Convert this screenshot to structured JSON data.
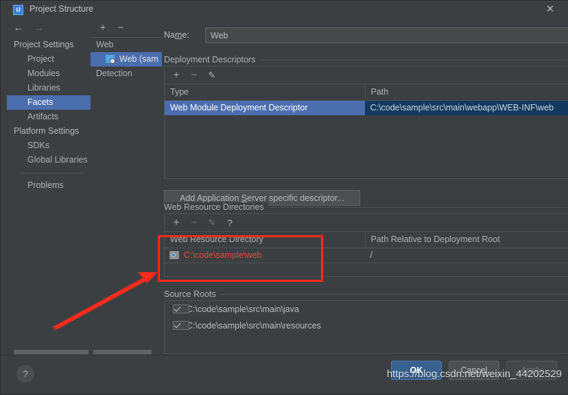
{
  "window": {
    "title": "Project Structure",
    "app_icon": "IJ",
    "close_icon": "✕"
  },
  "nav": {
    "back_icon": "←",
    "forward_icon": "→",
    "items": [
      {
        "label": "Project Settings",
        "type": "group",
        "selected": false
      },
      {
        "label": "Project",
        "type": "child",
        "selected": false
      },
      {
        "label": "Modules",
        "type": "child",
        "selected": false
      },
      {
        "label": "Libraries",
        "type": "child",
        "selected": false
      },
      {
        "label": "Facets",
        "type": "child",
        "selected": true
      },
      {
        "label": "Artifacts",
        "type": "child",
        "selected": false
      },
      {
        "label": "Platform Settings",
        "type": "group",
        "selected": false
      },
      {
        "label": "SDKs",
        "type": "child",
        "selected": false
      },
      {
        "label": "Global Libraries",
        "type": "child",
        "selected": false
      },
      {
        "label": "Problems",
        "type": "child-after-sep",
        "selected": false
      }
    ]
  },
  "facet_tree": {
    "add_icon": "+",
    "remove_icon": "−",
    "items": [
      {
        "label": "Web",
        "type": "root",
        "selected": false
      },
      {
        "label": "Web (sam",
        "type": "leaf",
        "selected": true
      },
      {
        "label": "Detection",
        "type": "root",
        "selected": false
      }
    ]
  },
  "facet_form": {
    "name_label_pre": "Na",
    "name_label_mnemonic": "m",
    "name_label_post": "e:",
    "name_value": "Web"
  },
  "deployment_descriptors": {
    "section_title": "Deployment Descriptors",
    "toolbar": {
      "add_icon": "+",
      "remove_icon": "−",
      "edit_icon": "✎"
    },
    "columns": [
      "Type",
      "Path"
    ],
    "rows": [
      {
        "type": "Web Module Deployment Descriptor",
        "path": "C:\\code\\sample\\src\\main\\webapp\\WEB-INF\\web",
        "selected": true
      }
    ],
    "add_button_pre": "Add Application ",
    "add_button_mnemonic": "S",
    "add_button_post": "erver specific descriptor..."
  },
  "web_resource_directories": {
    "section_title": "Web Resource Directories",
    "toolbar": {
      "add_icon": "+",
      "remove_icon": "−",
      "edit_icon": "✎",
      "help_icon": "?"
    },
    "columns": [
      "Web Resource Directory",
      "Path Relative to Deployment Root"
    ],
    "rows": [
      {
        "directory": "C:\\code\\sample\\web",
        "relative_path": "/",
        "directory_icon": "folder-icon",
        "highlight_color": "#e8453c"
      }
    ]
  },
  "source_roots": {
    "section_title": "Source Roots",
    "items": [
      {
        "label": "C:\\code\\sample\\src\\main\\java",
        "checked": true
      },
      {
        "label": "C:\\code\\sample\\src\\main\\resources",
        "checked": true
      }
    ]
  },
  "footer": {
    "help_icon": "?",
    "ok_label": "OK",
    "cancel_label": "Cancel",
    "apply_label": "Apply"
  },
  "watermark": {
    "text": "https://blog.csdn.net/weixin_44202529"
  },
  "annotation": {
    "box_color": "#fc2b1c",
    "arrow_color": "#fc2b1c"
  }
}
